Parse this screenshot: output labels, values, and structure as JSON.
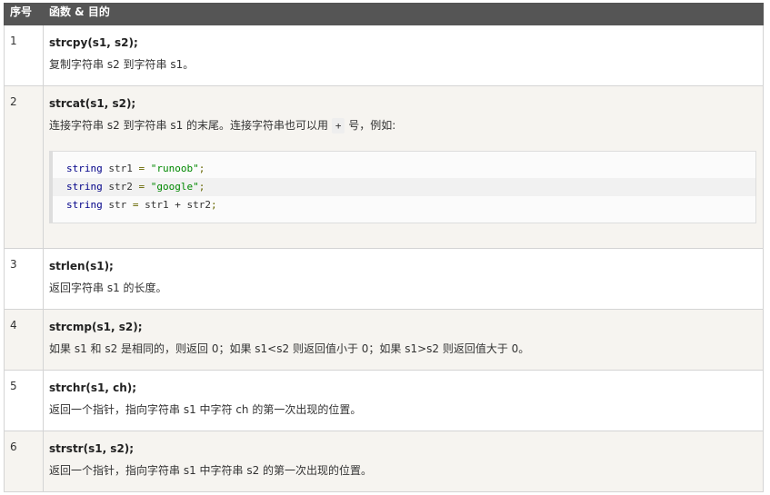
{
  "header": {
    "num": "序号",
    "fn": "函数 & 目的"
  },
  "rows": [
    {
      "num": "1",
      "sig": "strcpy(s1, s2);",
      "desc": "复制字符串 s2 到字符串 s1。"
    },
    {
      "num": "2",
      "sig": "strcat(s1, s2);",
      "desc_before": "连接字符串 s2 到字符串 s1 的末尾。连接字符串也可以用 ",
      "desc_code": "+",
      "desc_after": " 号，例如:",
      "code": {
        "line1": {
          "kw": "string",
          "var": " str1 ",
          "op": "=",
          "str": " \"runoob\"",
          "end": ";"
        },
        "line2": {
          "kw": "string",
          "var": " str2 ",
          "op": "=",
          "str": " \"google\"",
          "end": ";"
        },
        "line3": {
          "kw": "string",
          "var": " str ",
          "op": "=",
          "expr": " str1 + str2",
          "end": ";"
        }
      }
    },
    {
      "num": "3",
      "sig": "strlen(s1);",
      "desc": "返回字符串 s1 的长度。"
    },
    {
      "num": "4",
      "sig": "strcmp(s1, s2);",
      "desc": "如果 s1 和 s2 是相同的，则返回 0；如果 s1<s2 则返回值小于 0；如果 s1>s2 则返回值大于 0。"
    },
    {
      "num": "5",
      "sig": "strchr(s1, ch);",
      "desc": "返回一个指针，指向字符串 s1 中字符 ch 的第一次出现的位置。"
    },
    {
      "num": "6",
      "sig": "strstr(s1, s2);",
      "desc": "返回一个指针，指向字符串 s1 中字符串 s2 的第一次出现的位置。"
    }
  ]
}
